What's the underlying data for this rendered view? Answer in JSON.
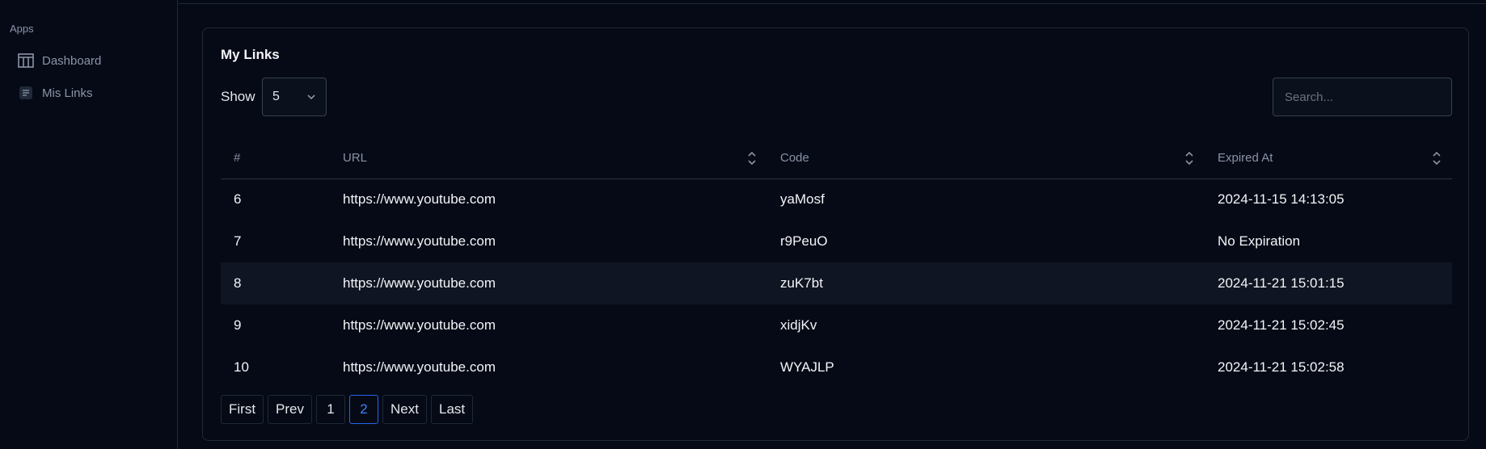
{
  "sidebar": {
    "section": "Apps",
    "items": [
      {
        "label": "Dashboard",
        "icon": "columns-icon"
      },
      {
        "label": "Mis Links",
        "icon": "document-icon"
      }
    ]
  },
  "card": {
    "title": "My Links",
    "show_label": "Show",
    "page_size": "5",
    "search_placeholder": "Search..."
  },
  "table": {
    "headers": [
      "#",
      "URL",
      "Code",
      "Expired At"
    ],
    "rows": [
      [
        "6",
        "https://www.youtube.com",
        "yaMosf",
        "2024-11-15 14:13:05"
      ],
      [
        "7",
        "https://www.youtube.com",
        "r9PeuO",
        "No Expiration"
      ],
      [
        "8",
        "https://www.youtube.com",
        "zuK7bt",
        "2024-11-21 15:01:15"
      ],
      [
        "9",
        "https://www.youtube.com",
        "xidjKv",
        "2024-11-21 15:02:45"
      ],
      [
        "10",
        "https://www.youtube.com",
        "WYAJLP",
        "2024-11-21 15:02:58"
      ]
    ]
  },
  "pagination": {
    "first": "First",
    "prev": "Prev",
    "pages": [
      "1",
      "2"
    ],
    "current": "2",
    "next": "Next",
    "last": "Last"
  },
  "colors": {
    "background": "#050a16",
    "accent": "#3b82f6",
    "border": "#1f2937"
  }
}
